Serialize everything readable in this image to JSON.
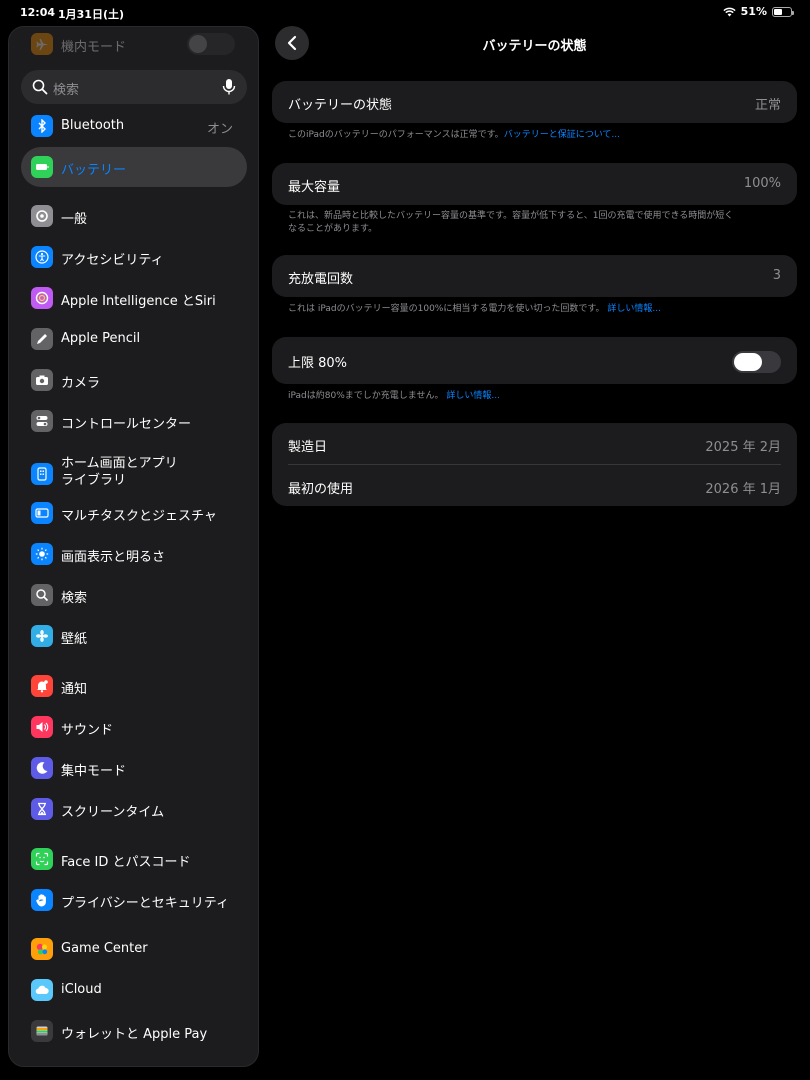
{
  "status_bar": {
    "time": "12:04",
    "date": "1月31日(土)",
    "battery_percent": "51%",
    "battery_level": 0.51
  },
  "sidebar": {
    "airplane_label": "機内モード",
    "search_placeholder": "検索",
    "items": [
      {
        "label": "Bluetooth",
        "value": "オン",
        "icon": "bluetooth-icon",
        "color": "#0a84ff"
      },
      {
        "label": "バッテリー",
        "icon": "battery-icon",
        "color": "#30d158",
        "selected": true
      },
      {
        "label": "一般",
        "icon": "gear-icon",
        "color": "#8e8e93"
      },
      {
        "label": "アクセシビリティ",
        "icon": "accessibility-icon",
        "color": "#0a84ff"
      },
      {
        "label": "Apple Intelligence とSiri",
        "icon": "apple-intelligence-icon",
        "color": "#bf5af2"
      },
      {
        "label": "Apple Pencil",
        "icon": "pencil-icon",
        "color": "#636366"
      },
      {
        "label": "カメラ",
        "icon": "camera-icon",
        "color": "#636366"
      },
      {
        "label": "コントロールセンター",
        "icon": "control-center-icon",
        "color": "#636366"
      },
      {
        "label": "ホーム画面とアプリライブラリ",
        "line1": "ホーム画面とアプリ",
        "line2": "ライブラリ",
        "icon": "home-screen-icon",
        "color": "#0a84ff"
      },
      {
        "label": "マルチタスクとジェスチャ",
        "icon": "multitasking-icon",
        "color": "#0a84ff"
      },
      {
        "label": "画面表示と明るさ",
        "icon": "brightness-icon",
        "color": "#0a84ff"
      },
      {
        "label": "検索",
        "icon": "search-icon",
        "color": "#636366"
      },
      {
        "label": "壁紙",
        "icon": "wallpaper-icon",
        "color": "#32ade6"
      },
      {
        "label": "通知",
        "icon": "notification-icon",
        "color": "#ff453a"
      },
      {
        "label": "サウンド",
        "icon": "sound-icon",
        "color": "#ff375f"
      },
      {
        "label": "集中モード",
        "icon": "moon-icon",
        "color": "#5e5ce6"
      },
      {
        "label": "スクリーンタイム",
        "icon": "hourglass-icon",
        "color": "#5e5ce6"
      },
      {
        "label": "Face ID とパスコード",
        "icon": "face-id-icon",
        "color": "#30d158"
      },
      {
        "label": "プライバシーとセキュリティ",
        "icon": "hand-icon",
        "color": "#0a84ff"
      },
      {
        "label": "Game Center",
        "icon": "game-center-icon",
        "color": "#ff9f0a"
      },
      {
        "label": "iCloud",
        "icon": "cloud-icon",
        "color": "#5ac8fa"
      },
      {
        "label": "ウォレットと Apple Pay",
        "icon": "wallet-icon",
        "color": "#3a3a3c"
      }
    ]
  },
  "main": {
    "title": "バッテリーの状態",
    "health": {
      "label": "バッテリーの状態",
      "value": "正常",
      "note": "このiPadのバッテリーのパフォーマンスは正常です。",
      "note_link": "バッテリーと保証について..."
    },
    "capacity": {
      "label": "最大容量",
      "value": "100%",
      "note_line1": "これは、新品時と比較したバッテリー容量の基準です。容量が低下すると、1回の充電で使用できる時間が短く",
      "note_line2": "なることがあります。"
    },
    "cycle": {
      "label": "充放電回数",
      "value": "3",
      "note": "これは iPadのバッテリー容量の100%に相当する電力を使い切った回数です。",
      "note_link": "詳しい情報..."
    },
    "limit": {
      "label": "上限 80%",
      "enabled": false,
      "note": "iPadは約80%までしか充電しません。",
      "note_link": "詳しい情報..."
    },
    "dates": {
      "manufacture_label": "製造日",
      "manufacture_value": "2025 年 2月",
      "first_use_label": "最初の使用",
      "first_use_value": "2026 年 1月"
    }
  }
}
